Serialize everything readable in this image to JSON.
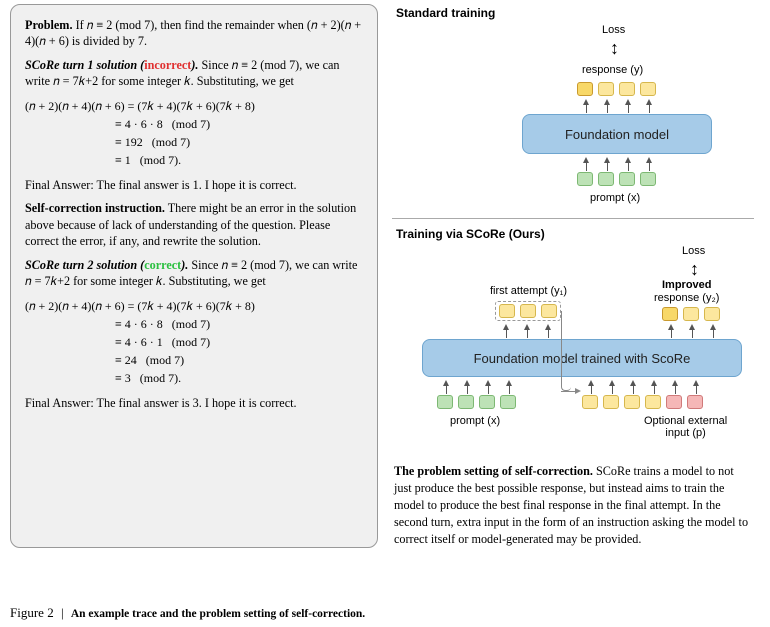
{
  "left": {
    "problem_label": "Problem.",
    "problem_text": "If 𝑛 ≡ 2 (mod 7), then find the remainder when (𝑛 + 2)(𝑛 + 4)(𝑛 + 6) is divided by 7.",
    "turn1_label": "SCoRe turn 1 solution (",
    "turn1_status": "incorrect",
    "turn1_label_tail": ").",
    "turn1_text": "Since 𝑛 ≡ 2 (mod 7), we can write 𝑛 = 7𝑘+2 for some integer 𝑘. Substituting, we get",
    "math1": "(𝑛 + 2)(𝑛 + 4)(𝑛 + 6) = (7𝑘 + 4)(7𝑘 + 6)(7𝑘 + 8)\n                              ≡ 4 · 6 · 8   (mod 7)\n                              ≡ 192   (mod 7)\n                              ≡ 1   (mod 7).",
    "final1": "Final Answer: The final answer is 1. I hope it is correct.",
    "selfcorr_label": "Self-correction instruction.",
    "selfcorr_text": "There might be an error in the solution above because of lack of understanding of the question. Please correct the error, if any, and rewrite the solution.",
    "turn2_label": "SCoRe turn 2 solution (",
    "turn2_status": "correct",
    "turn2_label_tail": ").",
    "turn2_text": "Since 𝑛 ≡ 2 (mod 7), we can write 𝑛 = 7𝑘+2 for some integer 𝑘. Substituting, we get",
    "math2": "(𝑛 + 2)(𝑛 + 4)(𝑛 + 6) = (7𝑘 + 4)(7𝑘 + 6)(7𝑘 + 8)\n                              ≡ 4 · 6 · 8   (mod 7)\n                              ≡ 4 · 6 · 1   (mod 7)\n                              ≡ 24   (mod 7)\n                              ≡ 3   (mod 7).",
    "final2": "Final Answer: The final answer is 3. I hope it is correct."
  },
  "right": {
    "std_header": "Standard training",
    "score_header": "Training via SCoRe (Ours)",
    "loss": "Loss",
    "response_y": "response (y)",
    "prompt_x": "prompt (x)",
    "foundation1": "Foundation model",
    "foundation2": "Foundation model trained with ScoRe",
    "first_attempt": "first attempt (y₁)",
    "improved": "Improved",
    "response_y2": "response (y₂)",
    "optional_input": "Optional external\ninput (p)",
    "caption_bold": "The problem setting of self-correction.",
    "caption_rest": " SCoRe trains a model to not just produce the best possible response, but instead aims to train the model to produce the best final response in the final attempt. In the second turn, extra input in the form of an instruction asking the model to correct itself or model-generated may be provided."
  },
  "figure": {
    "label": "Figure 2",
    "sep": "|",
    "desc": "An example trace and the problem setting of self-correction."
  }
}
